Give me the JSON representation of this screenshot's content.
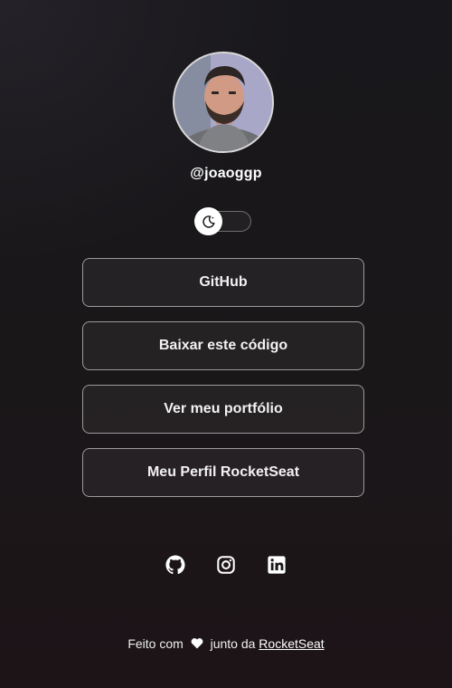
{
  "profile": {
    "username": "@joaoggp"
  },
  "theme_toggle": {
    "icon": "moon-icon"
  },
  "links": [
    {
      "label": "GitHub"
    },
    {
      "label": "Baixar este código"
    },
    {
      "label": "Ver meu portfólio"
    },
    {
      "label": "Meu Perfil RocketSeat"
    }
  ],
  "socials": [
    {
      "icon": "github-icon"
    },
    {
      "icon": "instagram-icon"
    },
    {
      "icon": "linkedin-icon"
    }
  ],
  "footer": {
    "prefix": "Feito com",
    "icon": "heart-icon",
    "middle": "junto da",
    "link": "RocketSeat"
  }
}
